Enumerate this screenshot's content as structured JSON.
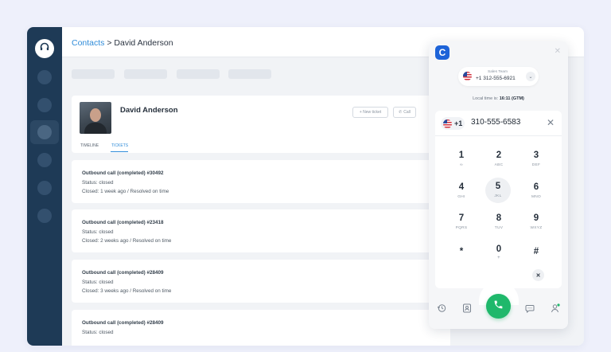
{
  "breadcrumb": {
    "link": "Contacts",
    "separator": " > ",
    "current": "David Anderson"
  },
  "contact": {
    "name": "David Anderson",
    "new_ticket_label": "+ New ticket",
    "call_label": "Call",
    "tabs": [
      {
        "label": "TIMELINE"
      },
      {
        "label": "TICKETS",
        "active": true
      }
    ]
  },
  "tickets": [
    {
      "title": "Outbound call (completed) #30492",
      "status": "Status: closed",
      "closed": "Closed: 1 week ago / Resolved on time"
    },
    {
      "title": "Outbound call (completed) #23418",
      "status": "Status: closed",
      "closed": "Closed: 2 weeks ago / Resolved on time"
    },
    {
      "title": "Outbound call (completed) #28409",
      "status": "Status: closed",
      "closed": "Closed: 3 weeks ago / Resolved on time"
    },
    {
      "title": "Outbound call (completed) #28409",
      "status": "Status: closed",
      "closed": ""
    }
  ],
  "dialer": {
    "line_name": "Sales Team",
    "line_number": "+1 312-555-6921",
    "local_time_prefix": "Local time is: ",
    "local_time_value": "16:11 (GTM)",
    "country_code": "+1",
    "dialed_number": "310-555-6583",
    "keys": [
      {
        "digit": "1",
        "letters": "∞"
      },
      {
        "digit": "2",
        "letters": "ABC"
      },
      {
        "digit": "3",
        "letters": "DEF"
      },
      {
        "digit": "4",
        "letters": "GHI"
      },
      {
        "digit": "5",
        "letters": "JKL"
      },
      {
        "digit": "6",
        "letters": "MNO"
      },
      {
        "digit": "7",
        "letters": "PQRS"
      },
      {
        "digit": "8",
        "letters": "TUV"
      },
      {
        "digit": "9",
        "letters": "WXYZ"
      },
      {
        "digit": "*",
        "letters": ""
      },
      {
        "digit": "0",
        "letters": "+"
      },
      {
        "digit": "#",
        "letters": ""
      }
    ]
  },
  "colors": {
    "accent": "#2f8cd9",
    "sidebar": "#1e3a56",
    "call_green": "#1fb86b",
    "dialer_brand": "#1d63d8"
  },
  "icons": [
    "headset-icon",
    "phone-icon",
    "close-icon",
    "chevron-down-icon",
    "backspace-icon",
    "history-icon",
    "contacts-icon",
    "chat-icon",
    "user-status-icon"
  ]
}
